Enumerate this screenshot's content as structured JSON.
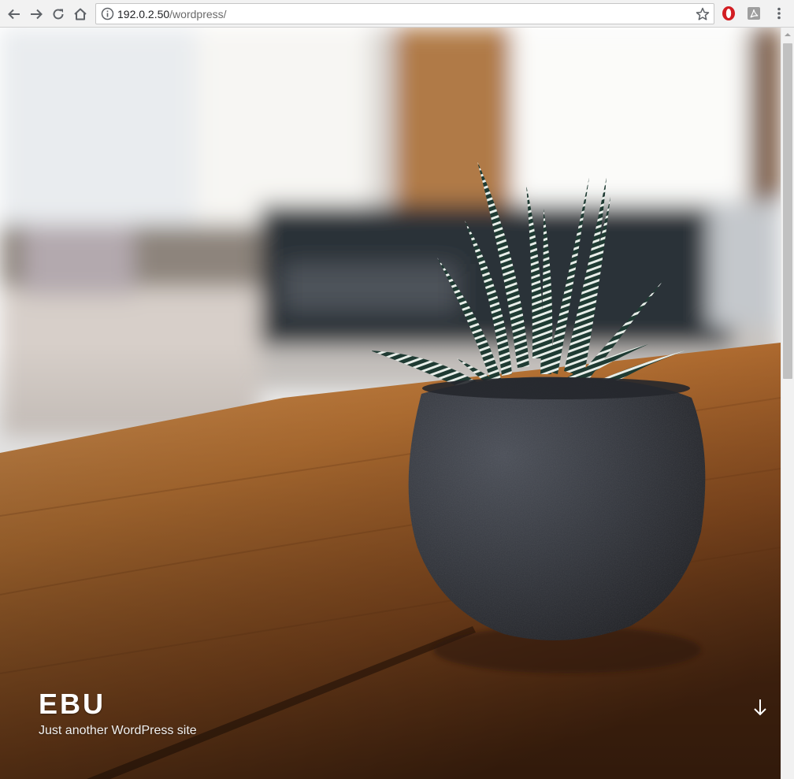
{
  "browser": {
    "url_host": "192.0.2.50",
    "url_path": "/wordpress/",
    "icons": {
      "back": "back-arrow-icon",
      "forward": "forward-arrow-icon",
      "reload": "reload-icon",
      "home": "home-icon",
      "info": "info-icon",
      "bookmark": "star-icon",
      "opera": "opera-extension-icon",
      "pdf": "pdf-extension-icon",
      "menu": "menu-kebab-icon"
    }
  },
  "hero": {
    "site_title": "EBU",
    "site_description": "Just another WordPress site",
    "scroll_icon": "arrow-down-icon"
  },
  "colors": {
    "toolbar_bg": "#f2f2f2",
    "opera_red": "#d21d22",
    "title_text": "#ffffff"
  }
}
